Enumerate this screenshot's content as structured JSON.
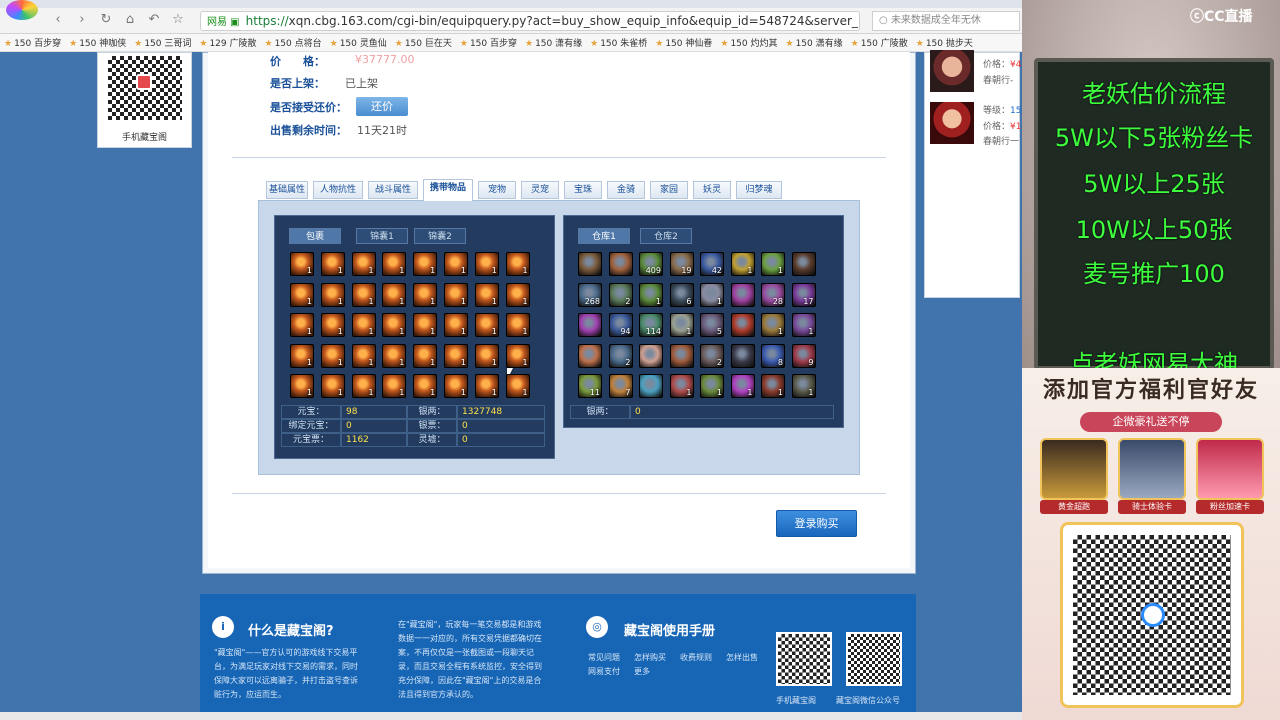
{
  "browser": {
    "url_prefix": "https://",
    "url_rest": "xqn.cbg.163.com/cgi-bin/equipquery.py?act=buy_show_equip_info&equip_id=548724&server_id=",
    "site_label": "网易 ▣",
    "search_text": "未来数据成全年无休",
    "bookmarks": [
      "150 百步穿",
      "150 神咖侠",
      "150 三哥词",
      "129 广陵散",
      "150 点将台",
      "150 灵鱼仙",
      "150 巨在天",
      "150 百步穿",
      "150 潇有缘",
      "150 朱雀桥",
      "150 神仙眷",
      "150 灼灼其",
      "150 潇有缘",
      "150 广陵散",
      "150 抛步天"
    ]
  },
  "listing": {
    "qr_caption": "手机藏宝阁",
    "price_label": "价　　格：",
    "price_value": "¥37777.00",
    "shelf_label": "是否上架：",
    "shelf_value": "已上架",
    "counter_label": "是否接受还价：",
    "counter_button": "还价",
    "remain_label": "出售剩余时间：",
    "remain_value": "11天21时"
  },
  "main_tabs": [
    "基础属性",
    "人物抗性",
    "战斗属性",
    "携带物品",
    "宠物",
    "灵宠",
    "宝珠",
    "金骑",
    "家园",
    "妖灵",
    "归梦魂"
  ],
  "active_tab": 3,
  "bag": {
    "tabs": [
      "包裹",
      "锦囊1",
      "锦囊2"
    ],
    "slot_color": "#c65a1e",
    "slots": [
      "1",
      "1",
      "1",
      "1",
      "1",
      "1",
      "1",
      "1",
      "1",
      "1",
      "1",
      "1",
      "1",
      "1",
      "1",
      "1",
      "1",
      "1",
      "1",
      "1",
      "1",
      "1",
      "1",
      "1",
      "1",
      "1",
      "1",
      "1",
      "1",
      "1",
      "1",
      "1",
      "1",
      "1",
      "1",
      "1",
      "1",
      "1",
      "1",
      "1"
    ],
    "info": [
      {
        "k": "元宝：",
        "v": "98",
        "k2": "银两：",
        "v2": "1327748"
      },
      {
        "k": "绑定元宝：",
        "v": "0",
        "k2": "银票：",
        "v2": "0"
      },
      {
        "k": "元宝票：",
        "v": "1162",
        "k2": "灵墟：",
        "v2": "0"
      }
    ]
  },
  "warehouse": {
    "tabs": [
      "仓库1",
      "仓库2"
    ],
    "slots": [
      {
        "n": "",
        "c": "#7a5a3a"
      },
      {
        "n": "",
        "c": "#a0603a"
      },
      {
        "n": "409",
        "c": "#5a8a3a"
      },
      {
        "n": "19",
        "c": "#8a6a4a"
      },
      {
        "n": "42",
        "c": "#3a5aa0"
      },
      {
        "n": "1",
        "c": "#c0a030"
      },
      {
        "n": "1",
        "c": "#6aa040"
      },
      {
        "n": "",
        "c": "#5a3a2a"
      },
      {
        "n": "268",
        "c": "#4a6a8a"
      },
      {
        "n": "2",
        "c": "#5a7a5a"
      },
      {
        "n": "1",
        "c": "#5a8a3a"
      },
      {
        "n": "6",
        "c": "#3a4a5a"
      },
      {
        "n": "1",
        "c": "#8a8aa0"
      },
      {
        "n": "",
        "c": "#a040a0"
      },
      {
        "n": "28",
        "c": "#9a4aa0"
      },
      {
        "n": "17",
        "c": "#7a3a9a"
      },
      {
        "n": "",
        "c": "#a040b0"
      },
      {
        "n": "94",
        "c": "#3a5a9a"
      },
      {
        "n": "114",
        "c": "#4a8a6a"
      },
      {
        "n": "1",
        "c": "#9aa090"
      },
      {
        "n": "5",
        "c": "#6a5a7a"
      },
      {
        "n": "",
        "c": "#b03a2a"
      },
      {
        "n": "1",
        "c": "#9a7a3a"
      },
      {
        "n": "1",
        "c": "#7a4a9a"
      },
      {
        "n": "",
        "c": "#c0704a"
      },
      {
        "n": "2",
        "c": "#4a6a8a"
      },
      {
        "n": "",
        "c": "#d0a090"
      },
      {
        "n": "",
        "c": "#a05a3a"
      },
      {
        "n": "2",
        "c": "#6a5a5a"
      },
      {
        "n": "",
        "c": "#3a3a4a"
      },
      {
        "n": "8",
        "c": "#3a5ab0"
      },
      {
        "n": "9",
        "c": "#a03a4a"
      },
      {
        "n": "11",
        "c": "#7a9a3a"
      },
      {
        "n": "7",
        "c": "#c0803a"
      },
      {
        "n": "",
        "c": "#4aa0c0"
      },
      {
        "n": "1",
        "c": "#b04a4a"
      },
      {
        "n": "1",
        "c": "#6a8a3a"
      },
      {
        "n": "1",
        "c": "#b040c0"
      },
      {
        "n": "1",
        "c": "#8a3a2a"
      },
      {
        "n": "1",
        "c": "#5a5a4a"
      }
    ],
    "info_k": "银两：",
    "info_v": "0"
  },
  "buy_button": "登录购买",
  "footer": {
    "what_title": "什么是藏宝阁?",
    "what_text": [
      "\"藏宝阁\"——官方认可的游戏线下交易平",
      "台，为满足玩家对线下交易的需求，同时",
      "保障大家可以远离骗子，并打击盗号查诉",
      "赃行为，应运而生。"
    ],
    "mid_text": [
      "在\"藏宝阁\"，玩家每一笔交易都是和游戏",
      "数据一一对应的，所有交易凭据都确切在",
      "案，不再仅仅是一张截图或一段聊天记",
      "录，而且交易全程有系统监控，安全得到",
      "充分保障，因此在\"藏宝阁\"上的交易是合",
      "法且得到官方承认的。"
    ],
    "manual_title": "藏宝阁使用手册",
    "links": [
      "常见问题",
      "怎样购买",
      "收费规则",
      "怎样出售",
      "网易支付",
      "更多"
    ],
    "qr1": "手机藏宝阁",
    "qr2": "藏宝阁微信公众号"
  },
  "sidebar": {
    "items": [
      {
        "l1": "价格：",
        "v1": "¥4",
        "l2": "春朝行-",
        "v2": ""
      },
      {
        "l1": "等级：",
        "v1": "15",
        "l2": "价格：",
        "v2": "¥1",
        "l3": "春朝行一"
      }
    ]
  },
  "stream": {
    "logo": "CC直播",
    "lines": [
      "老妖估价流程",
      "5W以下5张粉丝卡",
      "5W以上25张",
      "10W以上50张",
      "麦号推广100",
      "点老妖网易大神"
    ],
    "banner_title": "添加官方福利官好友",
    "banner_sub": "企微豪礼送不停",
    "cards": [
      "黄金超跑",
      "骑士体验卡",
      "粉丝加速卡"
    ]
  }
}
